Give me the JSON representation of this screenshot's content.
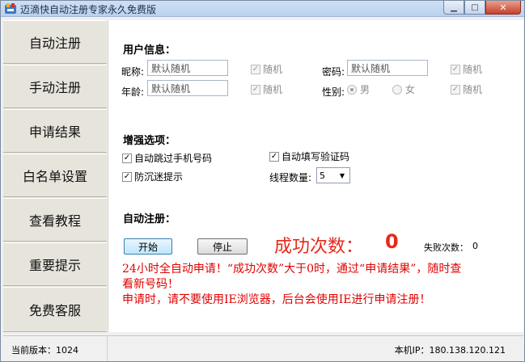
{
  "window": {
    "title": "迈滴快自动注册专家永久免费版",
    "app_icon": "app-logo-icon"
  },
  "sidebar": {
    "items": [
      {
        "label": "自动注册"
      },
      {
        "label": "手动注册"
      },
      {
        "label": "申请结果"
      },
      {
        "label": "白名单设置"
      },
      {
        "label": "查看教程"
      },
      {
        "label": "重要提示"
      },
      {
        "label": "免费客服"
      }
    ]
  },
  "user_info": {
    "section_title": "用户信息：",
    "nickname": {
      "label": "昵称:",
      "value": "默认随机",
      "random_label": "随机",
      "random_checked": true
    },
    "password": {
      "label": "密码:",
      "value": "默认随机",
      "random_label": "随机",
      "random_checked": true
    },
    "age": {
      "label": "年龄:",
      "value": "默认随机",
      "random_label": "随机",
      "random_checked": true
    },
    "gender": {
      "label": "性别:",
      "male": "男",
      "female": "女",
      "selected": "男",
      "random_label": "随机",
      "random_checked": true
    }
  },
  "enhance": {
    "section_title": "增强选项：",
    "skip_phone": {
      "label": "自动跳过手机号码",
      "checked": true
    },
    "auto_captcha": {
      "label": "自动填写验证码",
      "checked": true
    },
    "anti_addiction": {
      "label": "防沉迷提示",
      "checked": true
    },
    "threads": {
      "label": "线程数量:",
      "value": "5"
    }
  },
  "auto_register": {
    "section_title": "自动注册：",
    "start_label": "开始",
    "stop_label": "停止",
    "success_label": "成功次数：",
    "success_count": "0",
    "fail_label": "失败次数：",
    "fail_count": "0",
    "notice_line1": "24小时全自动申请！“成功次数”大于0时，通过“申请结果”，随时查",
    "notice_line2": "看新号码！",
    "notice_line3": "申请时，请不要使用IE浏览器，后台会使用IE进行申请注册！"
  },
  "status": {
    "version_label": "当前版本：",
    "version": "1024",
    "ip_label": "本机IP：",
    "ip": "180.138.120.121"
  },
  "colors": {
    "accent_red": "#e8281c",
    "sidebar_bg": "#e7e4dc"
  }
}
